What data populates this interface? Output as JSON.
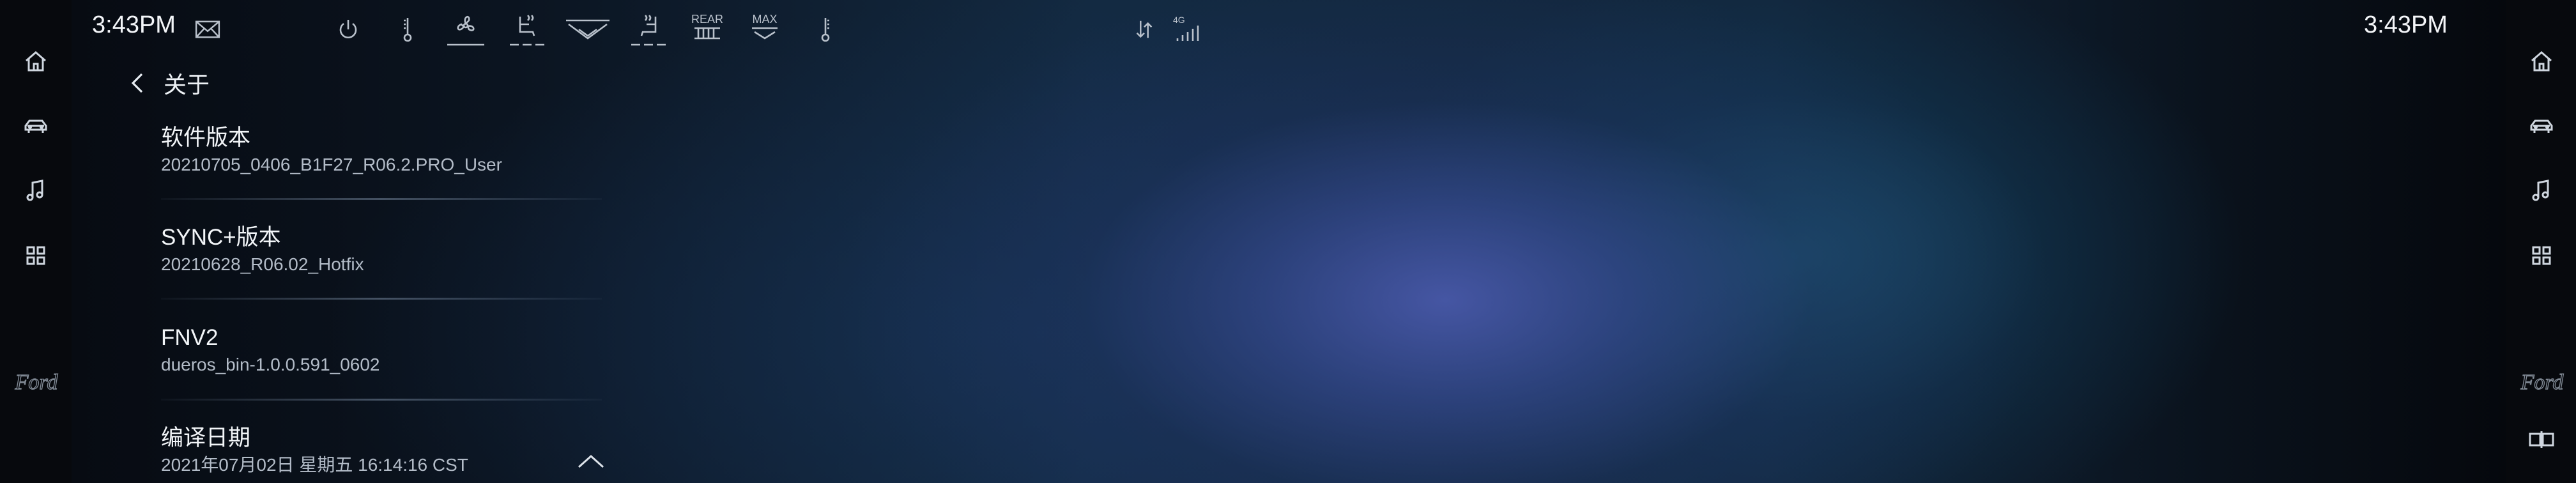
{
  "status_bar": {
    "time_left": "3:43PM",
    "time_right": "3:43PM",
    "climate_labels": {
      "rear": "REAR",
      "max": "MAX"
    },
    "signal": {
      "network": "4G"
    }
  },
  "page": {
    "back_title": "关于"
  },
  "about_items": [
    {
      "title": "软件版本",
      "value": "20210705_0406_B1F27_R06.2.PRO_User"
    },
    {
      "title": "SYNC+版本",
      "value": "20210628_R06.02_Hotfix"
    },
    {
      "title": "FNV2",
      "value": "dueros_bin-1.0.0.591_0602"
    },
    {
      "title": "编译日期",
      "value": "2021年07月02日 星期五 16:14:16 CST"
    }
  ],
  "rail_icons": {
    "left": [
      "home-icon",
      "car-icon",
      "music-note-icon",
      "apps-grid-icon"
    ],
    "right": [
      "home-icon",
      "car-icon",
      "music-note-icon",
      "apps-grid-icon",
      "split-screen-icon"
    ]
  },
  "brand": {
    "logo": "ford-logo"
  }
}
